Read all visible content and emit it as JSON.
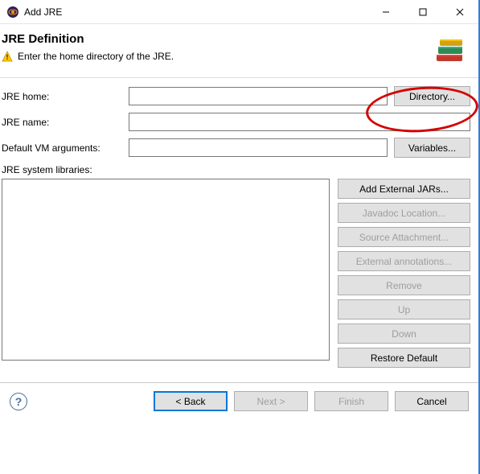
{
  "window": {
    "title": "Add JRE"
  },
  "header": {
    "title": "JRE Definition",
    "message": "Enter the home directory of the JRE."
  },
  "form": {
    "jre_home": {
      "label": "JRE home:",
      "value": "",
      "button": "Directory..."
    },
    "jre_name": {
      "label": "JRE name:",
      "value": ""
    },
    "vm_args": {
      "label": "Default VM arguments:",
      "value": "",
      "button": "Variables..."
    },
    "libs_label": "JRE system libraries:"
  },
  "lib_buttons": {
    "add_external": "Add External JARs...",
    "javadoc": "Javadoc Location...",
    "source": "Source Attachment...",
    "ext_annot": "External annotations...",
    "remove": "Remove",
    "up": "Up",
    "down": "Down",
    "restore": "Restore Default"
  },
  "footer": {
    "back": "< Back",
    "next": "Next >",
    "finish": "Finish",
    "cancel": "Cancel"
  }
}
